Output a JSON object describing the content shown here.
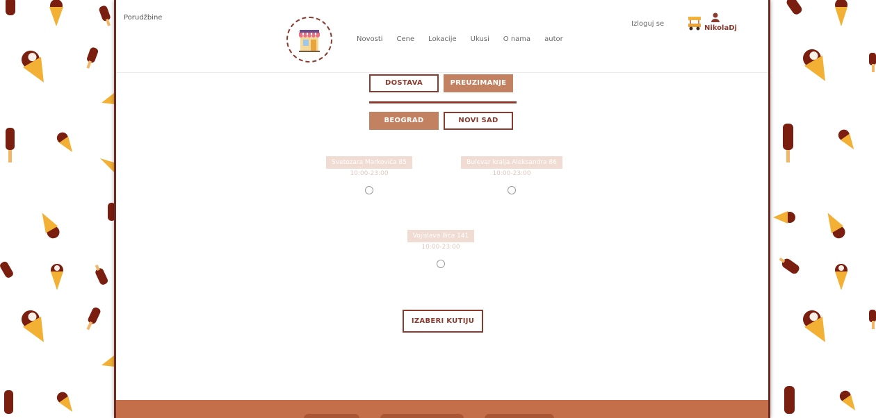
{
  "header": {
    "orders_link": "Porudžbine",
    "nav": [
      "Novosti",
      "Cene",
      "Lokacije",
      "Ukusi",
      "O nama",
      "autor"
    ],
    "logout": "Izloguj se",
    "username": "NikolaDj"
  },
  "delivery_toggle": {
    "delivery": "DOSTAVA",
    "pickup": "PREUZIMANJE",
    "active": "pickup"
  },
  "city_toggle": {
    "belgrade": "BEOGRAD",
    "novi_sad": "NOVI SAD",
    "active": "belgrade"
  },
  "locations": [
    {
      "address": "Svetozara Markovića 85",
      "hours": "10:00-23:00"
    },
    {
      "address": "Bulevar kralja Aleksandra 86",
      "hours": "10:00-23:00"
    },
    {
      "address": "Vojislava Ilića 141",
      "hours": "10:00-23:00"
    }
  ],
  "choose_box_button": "IZABERI KUTIJU",
  "colors": {
    "accent": "#8b3a2e",
    "active_button": "#c28161",
    "footer": "#c46e4a",
    "address_badge": "#f0dcd3"
  },
  "icons": {
    "logo": "ice-cream-shop-icon",
    "cart": "ice-cream-cart-icon",
    "user": "user-icon",
    "pattern": [
      "ice-cream-cone-icon",
      "popsicle-icon"
    ]
  }
}
